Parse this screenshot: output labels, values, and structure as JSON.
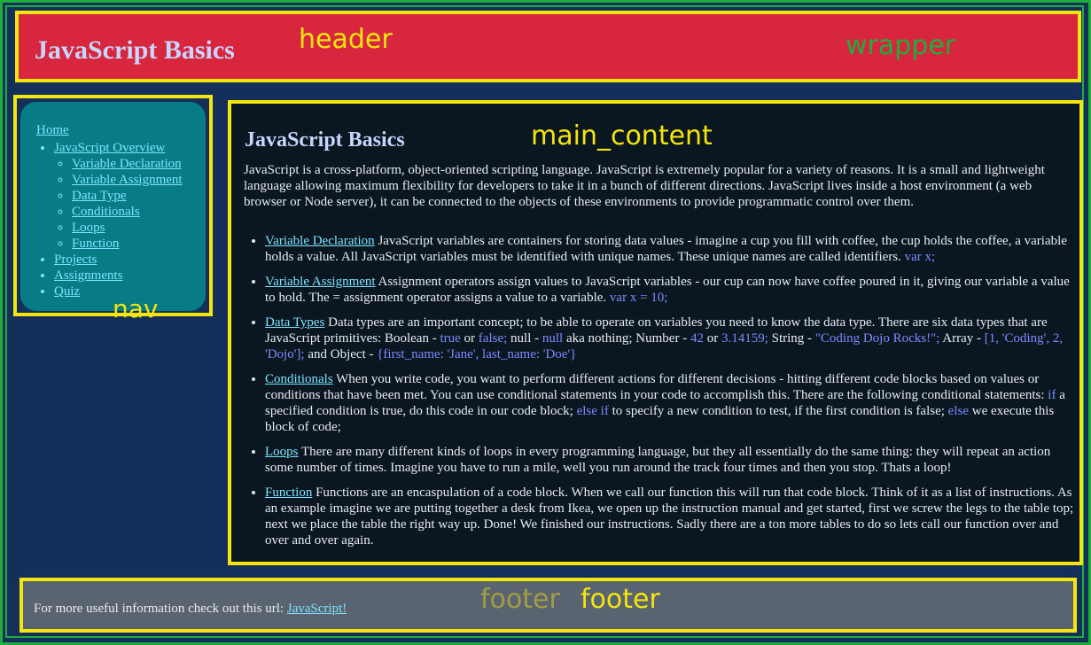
{
  "labels": {
    "header": "header",
    "wrapper": "wrapper",
    "nav": "nav",
    "main_content": "main_content",
    "footer_faded": "footer",
    "footer": "footer"
  },
  "header": {
    "title": "JavaScript Basics"
  },
  "nav": {
    "home": "Home",
    "items": [
      "JavaScript Overview",
      "Projects",
      "Assignments",
      "Quiz"
    ],
    "sub_items": [
      "Variable Declaration",
      "Variable Assignment",
      "Data Type",
      "Conditionals",
      "Loops",
      "Function"
    ]
  },
  "main": {
    "heading": "JavaScript Basics",
    "intro": "JavaScript is a cross-platform, object-oriented scripting language. JavaScript is extremely popular for a variety of reasons. It is a small and lightweight language allowing maximum flexibility for developers to take it in a bunch of different directions. JavaScript lives inside a host environment (a web browser or Node server), it can be connected to the objects of these environments to provide programmatic control over them.",
    "topics": [
      {
        "link": "Variable Declaration",
        "text": " JavaScript variables are containers for storing data values - imagine a cup you fill with coffee, the cup holds the coffee, a variable holds a value. All JavaScript variables must be identified with unique names. These unique names are called identifiers. ",
        "code": "var x;"
      },
      {
        "link": "Variable Assignment",
        "text": " Assignment operators assign values to JavaScript variables - our cup can now have coffee poured in it, giving our variable a value to hold. The = assignment operator assigns a value to a variable. ",
        "code": "var x = 10;"
      }
    ],
    "data_types": {
      "link": "Data Types",
      "t1": " Data types are an important concept; to be able to operate on variables you need to know the data type. There are six data types that are JavaScript primitives: Boolean - ",
      "c1": "true",
      "t2": " or ",
      "c2": "false;",
      "t3": " null - ",
      "c3": "null",
      "t4": " aka nothing; Number - ",
      "c4": "42",
      "t5": " or ",
      "c5": "3.14159;",
      "t6": " String - ",
      "c6": "\"Coding Dojo Rocks!\";",
      "t7": " Array - ",
      "c7": "[1, 'Coding', 2, 'Dojo'];",
      "t8": " and Object - ",
      "c8": "{first_name: 'Jane', last_name: 'Doe'}"
    },
    "conditionals": {
      "link": "Conditionals",
      "t1": " When you write code, you want to perform different actions for different decisions - hitting different code blocks based on values or conditions that have been met. You can use conditional statements in your code to accomplish this. There are the following conditional statements: ",
      "c1": "if",
      "t2": " a specified condition is true, do this code in our code block; ",
      "c2": "else if",
      "t3": " to specify a new condition to test, if the first condition is false; ",
      "c3": "else",
      "t4": " we execute this block of code;"
    },
    "loops": {
      "link": "Loops",
      "text": " There are many different kinds of loops in every programming language, but they all essentially do the same thing: they will repeat an action some number of times. Imagine you have to run a mile, well you run around the track four times and then you stop. Thats a loop!"
    },
    "function": {
      "link": "Function",
      "text": " Functions are an encaspulation of a code block. When we call our function this will run that code block. Think of it as a list of instructions. As an example imagine we are putting together a desk from Ikea, we open up the instruction manual and get started, first we screw the legs to the table top; next we place the table the right way up. Done! We finished our instructions. Sadly there are a ton more tables to do so lets call our function over and over and over again."
    }
  },
  "footer": {
    "text": "For more useful information check out this url: ",
    "link": "JavaScript!"
  }
}
